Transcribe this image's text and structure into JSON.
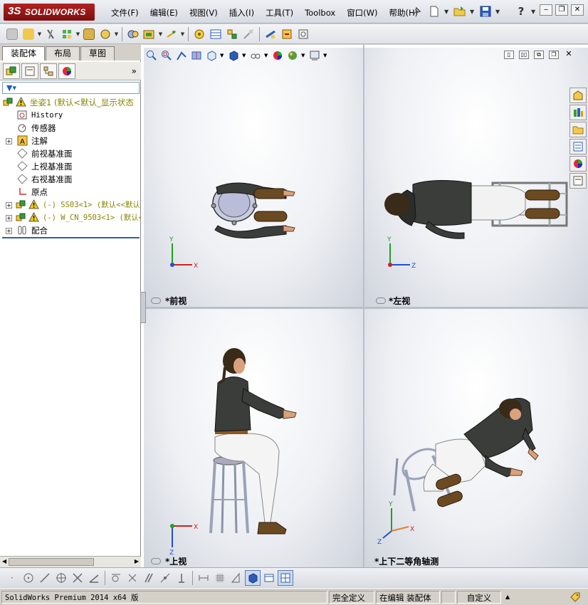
{
  "app": {
    "logo_ds": "3S",
    "logo_text": "SOLIDWORKS"
  },
  "menu": [
    "文件(F)",
    "编辑(E)",
    "视图(V)",
    "插入(I)",
    "工具(T)",
    "Toolbox",
    "窗口(W)",
    "帮助(H)"
  ],
  "panel": {
    "tabs": [
      "装配体",
      "布局",
      "草图"
    ],
    "active_tab": "装配体",
    "expand_glyph": "»"
  },
  "tree": {
    "root": "坐姿1  (默认<默认_显示状态",
    "nodes": {
      "history": "History",
      "sensors": "传感器",
      "annotations": "注解",
      "front_plane": "前视基准面",
      "top_plane": "上视基准面",
      "right_plane": "右视基准面",
      "origin": "原点",
      "comp1": "(-) SS03<1> (默认<<默认",
      "comp2": "(-) W_CN_9503<1> (默认<",
      "mates": "配合"
    }
  },
  "viewports": {
    "front": {
      "label": "*前视"
    },
    "left": {
      "label": "*左视"
    },
    "top": {
      "label": "*上视"
    },
    "iso": {
      "label": "*上下二等角轴测"
    }
  },
  "axes": {
    "x": "X",
    "y": "Y",
    "z": "Z"
  },
  "status": {
    "product": "SolidWorks Premium 2014 x64 版",
    "definition": "完全定义",
    "editing": "在编辑 装配体",
    "custom": "自定义",
    "custom_arrow": "▲"
  },
  "colors": {
    "accent_blue": "#2f5ea8",
    "brand_red": "#b42020",
    "axis_x": "#d02020",
    "axis_y": "#20a020",
    "axis_z": "#2050d0"
  }
}
